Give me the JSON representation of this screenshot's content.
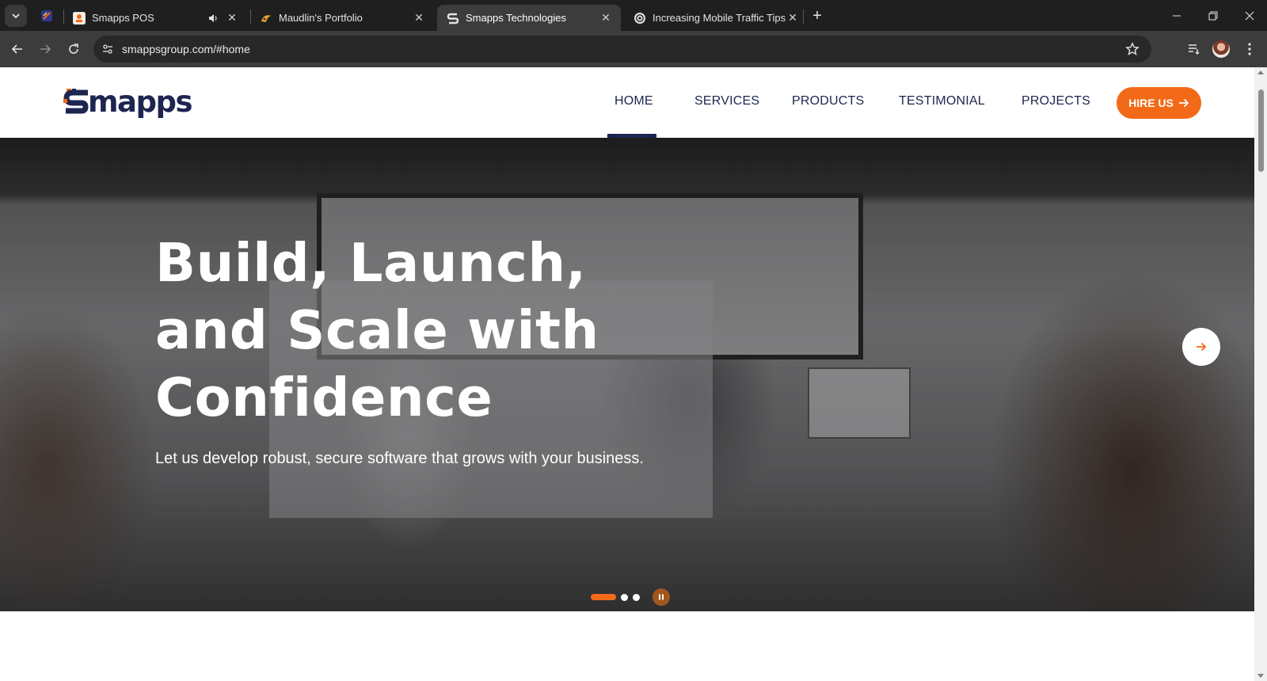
{
  "browser": {
    "tabs": [
      {
        "title": "Smapps POS",
        "active": false
      },
      {
        "title": "Maudlin's Portfolio",
        "active": false
      },
      {
        "title": "Smapps Technologies",
        "active": true
      },
      {
        "title": "Increasing Mobile Traffic Tips",
        "active": false
      }
    ],
    "url": "smappsgroup.com/#home"
  },
  "site": {
    "logo_text": "mapps",
    "nav": [
      "HOME",
      "SERVICES",
      "PRODUCTS",
      "TESTIMONIAL",
      "PROJECTS"
    ],
    "active_nav": "HOME",
    "hire_label": "HIRE US",
    "colors": {
      "primary": "#1d2550",
      "accent": "#f26a17"
    }
  },
  "hero": {
    "title": "Build, Launch, and Scale with Confidence",
    "subtitle": "Let us develop robust, secure software that grows with your business.",
    "slide_count": 3,
    "current_slide": 1
  }
}
